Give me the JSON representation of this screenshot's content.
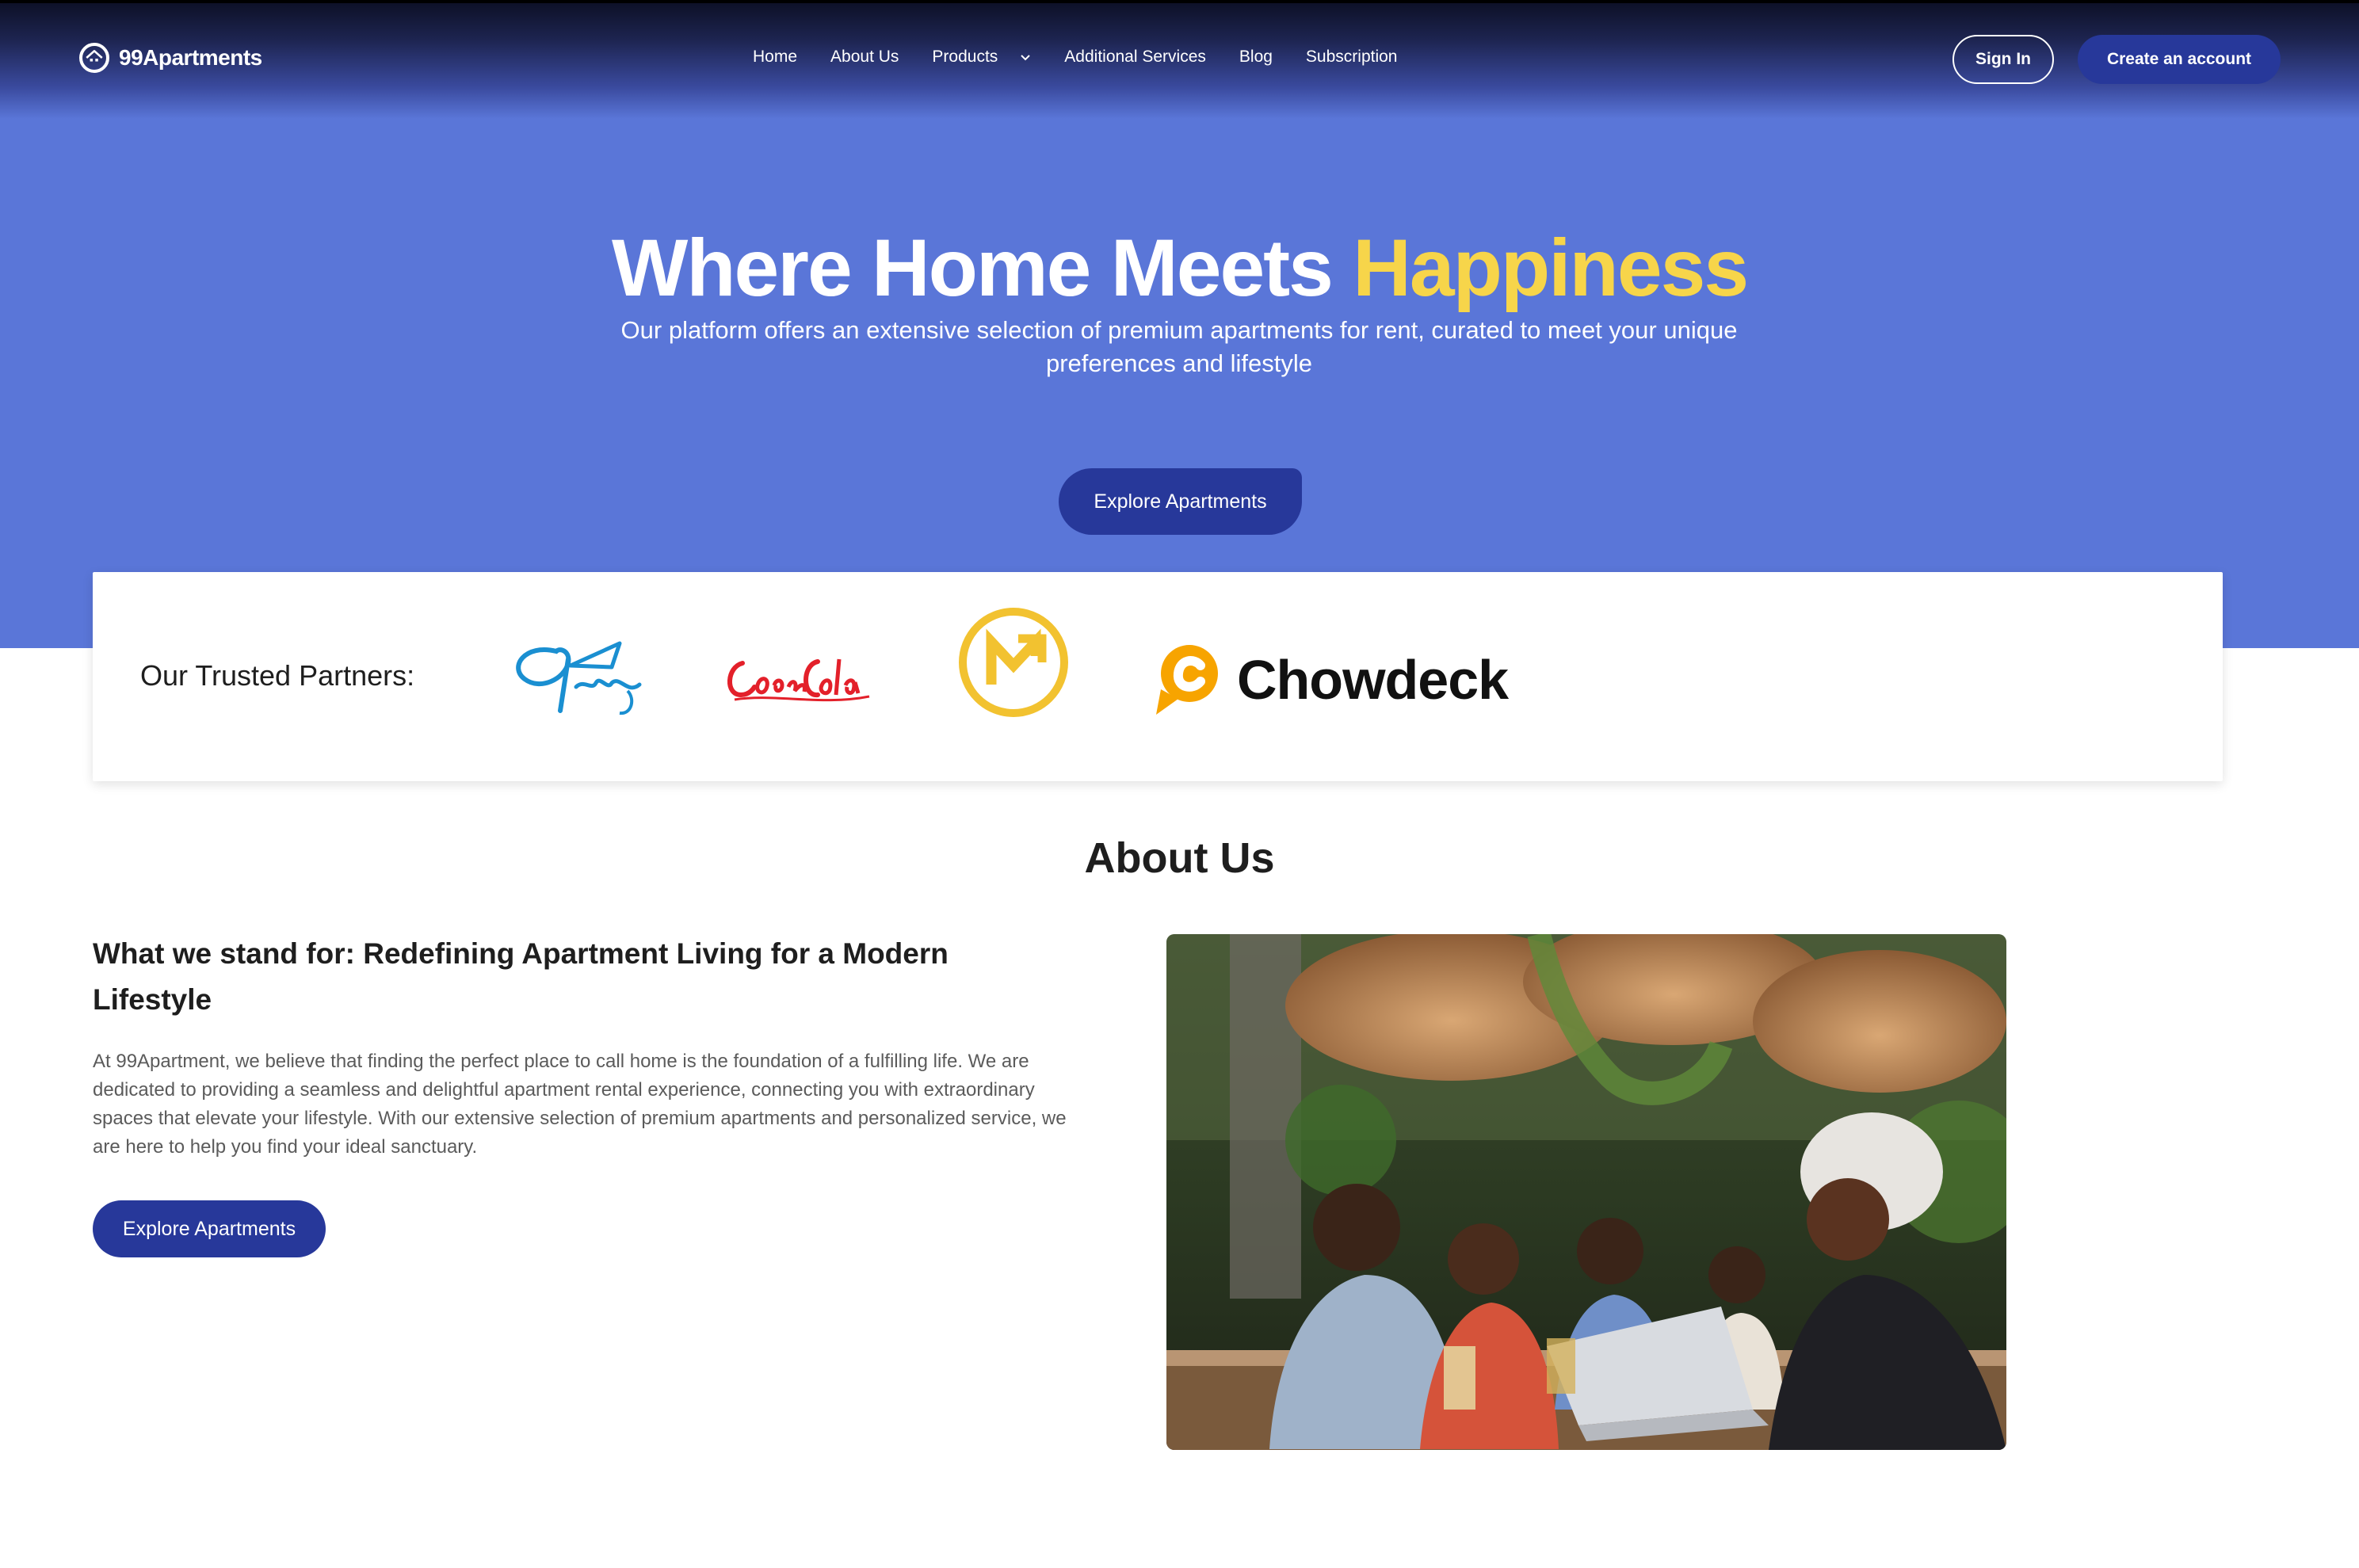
{
  "brand": {
    "name": "99Apartments"
  },
  "nav": {
    "home": "Home",
    "about": "About Us",
    "products": "Products",
    "services": "Additional Services",
    "blog": "Blog",
    "subscription": "Subscription"
  },
  "auth": {
    "sign_in": "Sign In",
    "create_account": "Create an account"
  },
  "hero": {
    "title_main": "Where Home Meets",
    "title_accent": "Happiness",
    "subtitle": "Our platform offers an extensive selection of premium apartments for rent, curated to meet your unique preferences and lifestyle",
    "cta": "Explore Apartments"
  },
  "partners": {
    "label": "Our Trusted Partners:",
    "logos": [
      "9redge",
      "Coca-Cola",
      "M",
      "Chowdeck"
    ],
    "chowdeck_text": "Chowdeck"
  },
  "about": {
    "heading": "About Us",
    "subheading": "What we stand for: Redefining Apartment Living for a Modern Lifestyle",
    "body": "At 99Apartment, we believe that finding the perfect place to call home is the foundation of a fulfilling life. We are dedicated to providing a seamless and delightful apartment rental experience, connecting you with extraordinary spaces that elevate your lifestyle. With our extensive selection of premium apartments and personalized service, we are here to help you find your ideal sanctuary.",
    "cta": "Explore Apartments"
  },
  "colors": {
    "hero_bg": "#5a76d8",
    "primary_button": "#27389a",
    "accent_yellow": "#f7d54a",
    "coca_cola_red": "#e3202a",
    "redge_blue": "#1a8fd1",
    "m_yellow": "#f2c230",
    "chowdeck_orange": "#f7a400"
  }
}
